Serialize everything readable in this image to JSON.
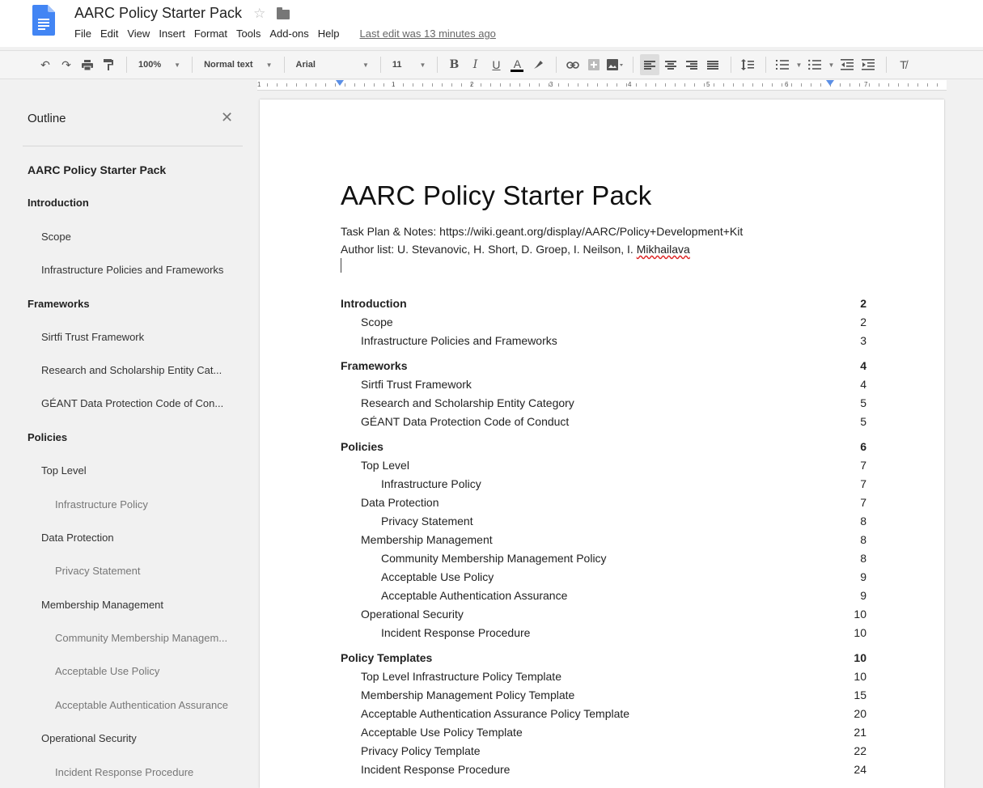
{
  "header": {
    "title": "AARC Policy Starter Pack",
    "menu": [
      "File",
      "Edit",
      "View",
      "Insert",
      "Format",
      "Tools",
      "Add-ons",
      "Help"
    ],
    "last_edit": "Last edit was 13 minutes ago"
  },
  "toolbar": {
    "zoom": "100%",
    "style": "Normal text",
    "font": "Arial",
    "size": "11",
    "bold": "B",
    "italic": "I",
    "underline": "U",
    "text_color": "A"
  },
  "ruler": {
    "numbers": [
      "1",
      "1",
      "2",
      "3",
      "4",
      "5",
      "6",
      "7"
    ]
  },
  "outline": {
    "title": "Outline",
    "items": [
      {
        "text": "AARC Policy Starter Pack",
        "level": 0
      },
      {
        "text": "Introduction",
        "level": 1
      },
      {
        "text": "Scope",
        "level": 2
      },
      {
        "text": "Infrastructure Policies and Frameworks",
        "level": 2
      },
      {
        "text": "Frameworks",
        "level": 1
      },
      {
        "text": "Sirtfi Trust Framework",
        "level": 2
      },
      {
        "text": "Research and Scholarship Entity Cat...",
        "level": 2
      },
      {
        "text": "GÉANT Data Protection Code of Con...",
        "level": 2
      },
      {
        "text": "Policies",
        "level": 1
      },
      {
        "text": "Top Level",
        "level": 2
      },
      {
        "text": "Infrastructure Policy",
        "level": 3
      },
      {
        "text": "Data Protection",
        "level": 2
      },
      {
        "text": "Privacy Statement",
        "level": 3
      },
      {
        "text": "Membership Management",
        "level": 2
      },
      {
        "text": "Community Membership Managem...",
        "level": 3
      },
      {
        "text": "Acceptable Use Policy",
        "level": 3
      },
      {
        "text": "Acceptable Authentication Assurance",
        "level": 3
      },
      {
        "text": "Operational Security",
        "level": 2
      },
      {
        "text": "Incident Response Procedure",
        "level": 3
      }
    ]
  },
  "document": {
    "title": "AARC Policy Starter Pack",
    "task_plan": "Task Plan & Notes: https://wiki.geant.org/display/AARC/Policy+Development+Kit",
    "author_prefix": "Author list: U. Stevanovic, H. Short, D. Groep, I. Neilson, I. ",
    "author_last": "Mikhailava",
    "toc": [
      {
        "text": "Introduction",
        "page": "2",
        "level": 1
      },
      {
        "text": "Scope",
        "page": "2",
        "level": 2
      },
      {
        "text": "Infrastructure Policies and Frameworks",
        "page": "3",
        "level": 2
      },
      {
        "text": "Frameworks",
        "page": "4",
        "level": 1
      },
      {
        "text": "Sirtfi Trust Framework",
        "page": "4",
        "level": 2
      },
      {
        "text": "Research and Scholarship Entity Category",
        "page": "5",
        "level": 2
      },
      {
        "text": "GÉANT Data Protection Code of Conduct",
        "page": "5",
        "level": 2
      },
      {
        "text": "Policies",
        "page": "6",
        "level": 1
      },
      {
        "text": "Top Level",
        "page": "7",
        "level": 2
      },
      {
        "text": "Infrastructure Policy",
        "page": "7",
        "level": 3
      },
      {
        "text": "Data Protection",
        "page": "7",
        "level": 2
      },
      {
        "text": "Privacy Statement",
        "page": "8",
        "level": 3
      },
      {
        "text": "Membership Management",
        "page": "8",
        "level": 2
      },
      {
        "text": "Community Membership Management Policy",
        "page": "8",
        "level": 3
      },
      {
        "text": "Acceptable Use Policy",
        "page": "9",
        "level": 3
      },
      {
        "text": "Acceptable Authentication Assurance",
        "page": "9",
        "level": 3
      },
      {
        "text": "Operational Security",
        "page": "10",
        "level": 2
      },
      {
        "text": "Incident Response Procedure",
        "page": "10",
        "level": 3
      },
      {
        "text": "Policy Templates",
        "page": "10",
        "level": 1
      },
      {
        "text": "Top Level Infrastructure Policy Template",
        "page": "10",
        "level": 2
      },
      {
        "text": "Membership Management Policy Template",
        "page": "15",
        "level": 2
      },
      {
        "text": "Acceptable Authentication Assurance Policy Template",
        "page": "20",
        "level": 2
      },
      {
        "text": "Acceptable Use Policy Template",
        "page": "21",
        "level": 2
      },
      {
        "text": "Privacy Policy Template",
        "page": "22",
        "level": 2
      },
      {
        "text": "Incident Response Procedure",
        "page": "24",
        "level": 2
      }
    ]
  },
  "colors": {
    "docs_blue": "#4285f4",
    "accent_blue": "#5b8fe6",
    "spell_red": "#d22"
  }
}
